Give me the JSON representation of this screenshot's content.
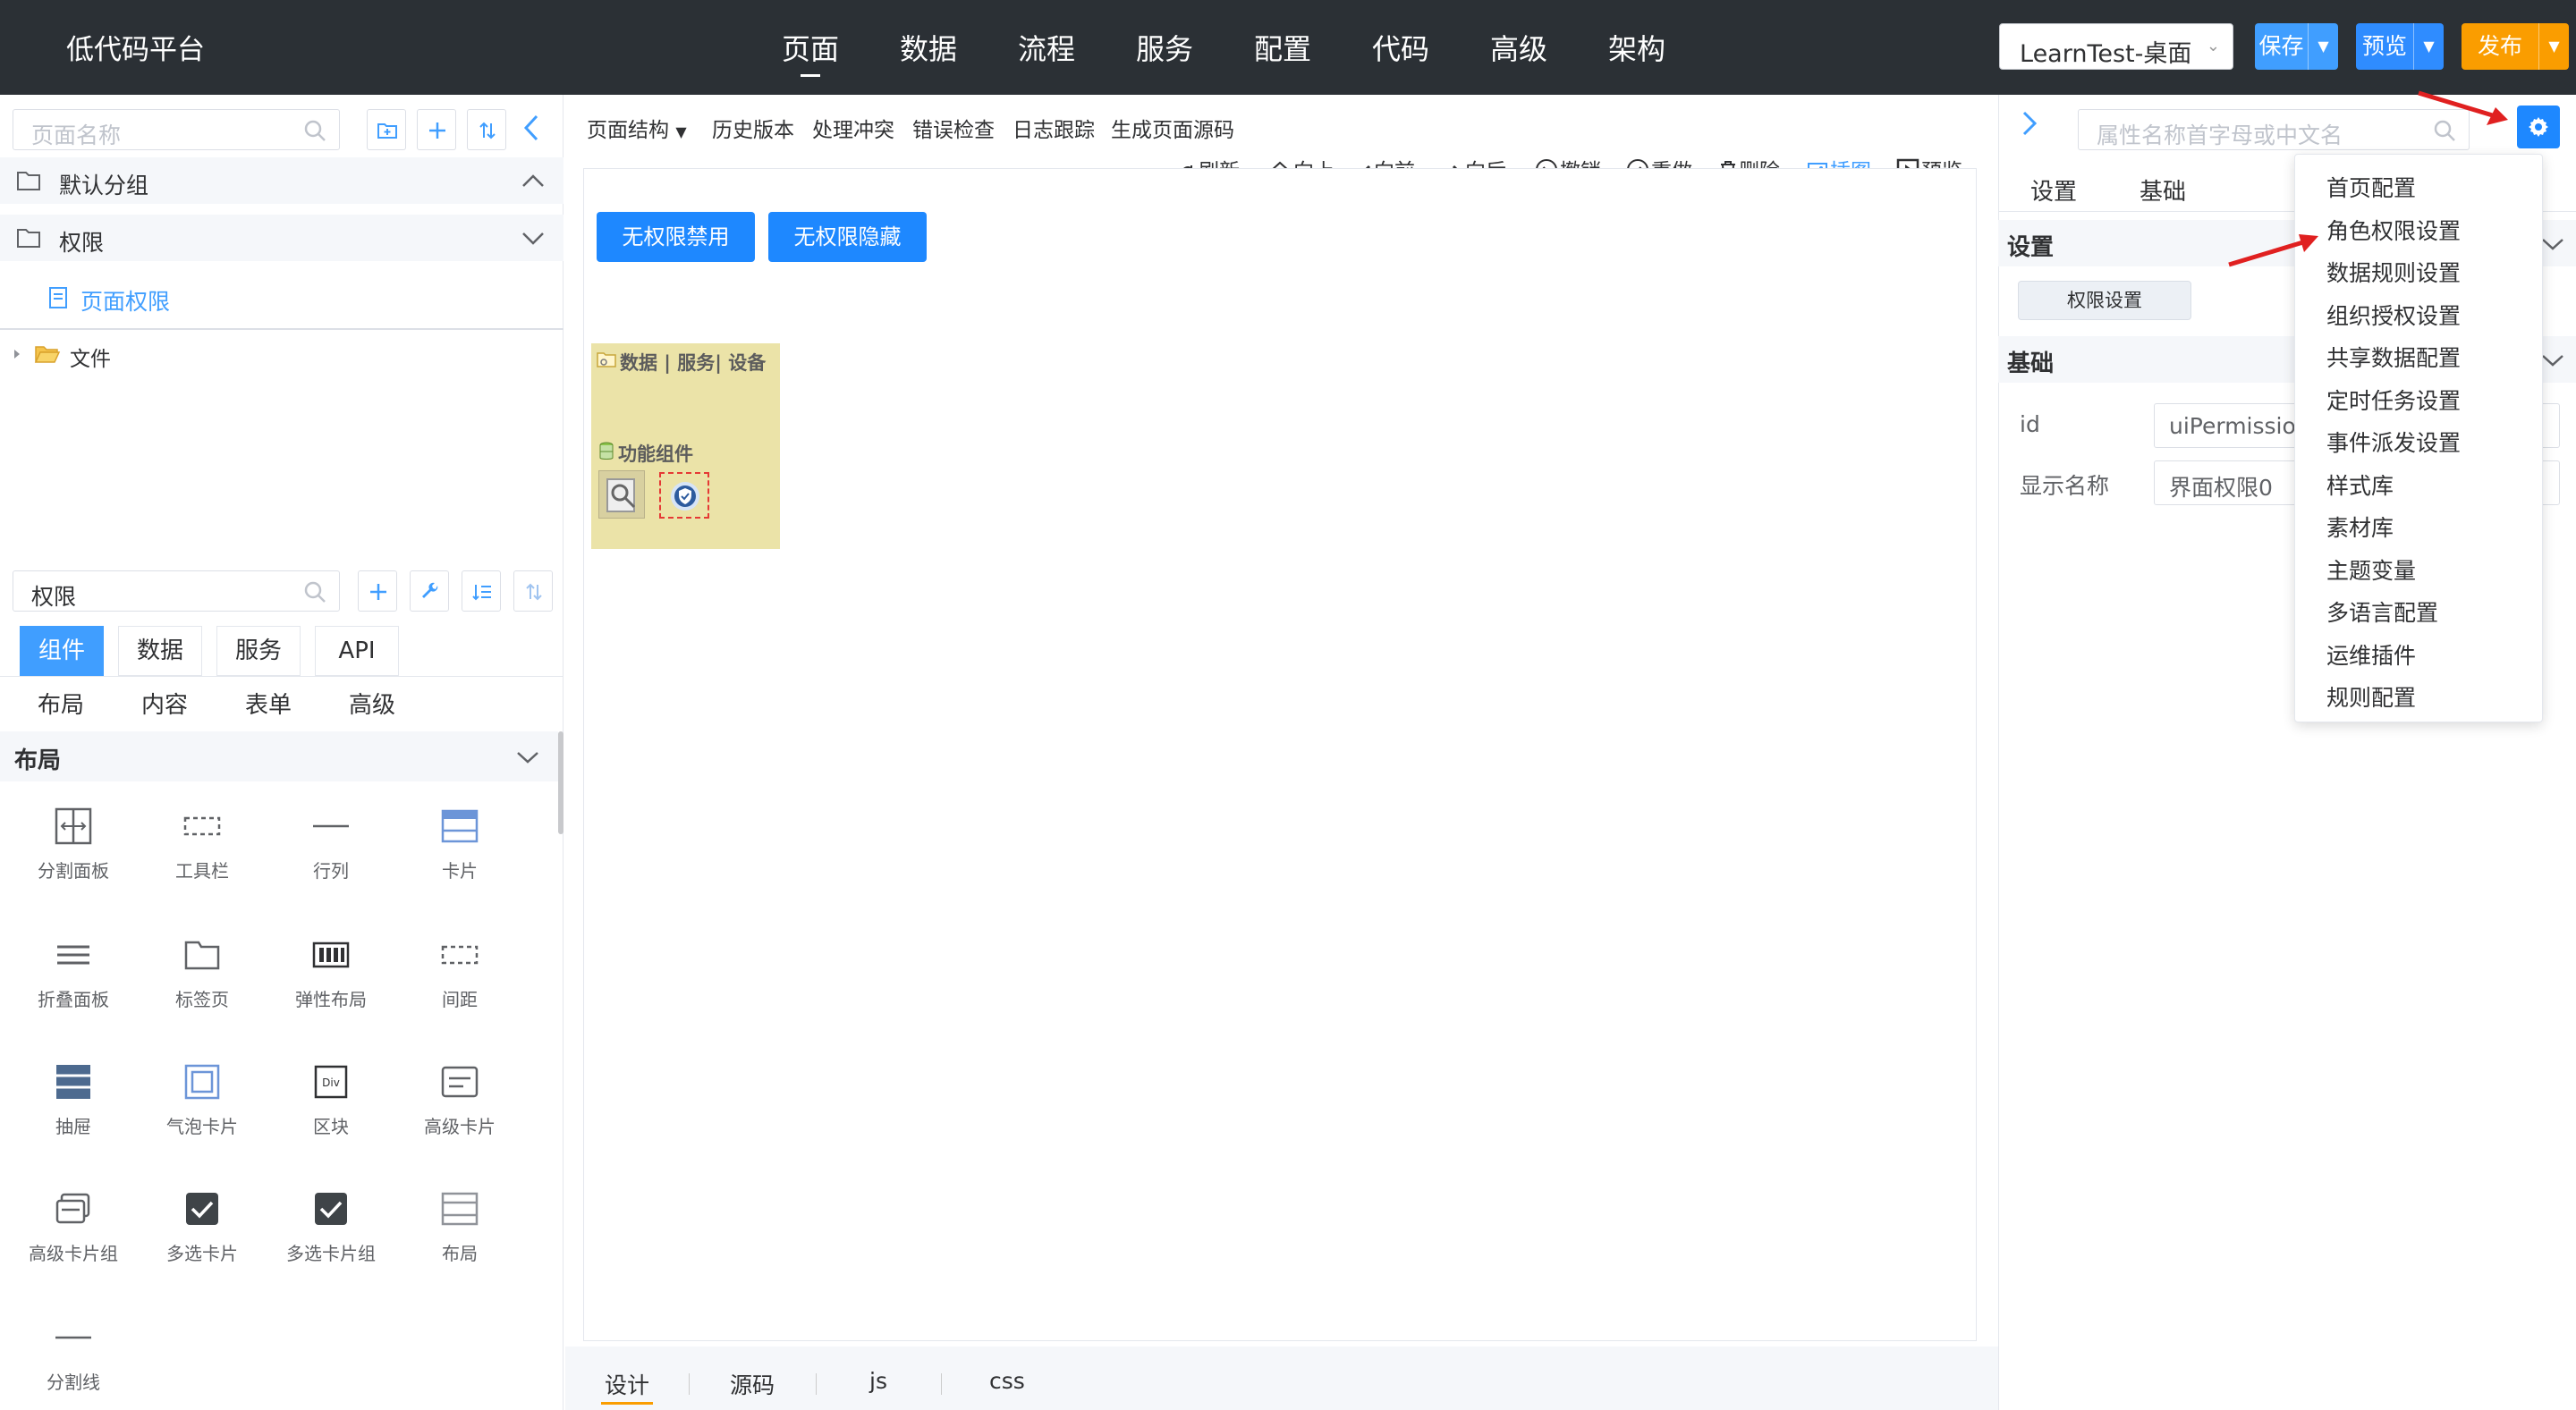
{
  "app": {
    "title": "低代码平台"
  },
  "nav": {
    "items": [
      "页面",
      "数据",
      "流程",
      "服务",
      "配置",
      "代码",
      "高级",
      "架构"
    ],
    "active": "页面"
  },
  "header": {
    "env_select": "LearnTest-桌面",
    "save_label": "保存",
    "preview_label": "预览",
    "publish_label": "发布",
    "colors": {
      "bar": "#2b3035",
      "save": "#409eff",
      "preview": "#2f8cff",
      "publish": "#fa9d00"
    }
  },
  "left": {
    "page_search_placeholder": "页面名称",
    "groups": [
      {
        "label": "默认分组",
        "expanded": true
      },
      {
        "label": "权限",
        "expanded": false
      }
    ],
    "selected_page": "页面权限",
    "file_node": "文件",
    "comp_search_value": "权限",
    "tabs": [
      "组件",
      "数据",
      "服务",
      "API"
    ],
    "active_tab": "组件",
    "sub_tabs": [
      "布局",
      "内容",
      "表单",
      "高级"
    ],
    "section_title": "布局",
    "components": [
      "分割面板",
      "工具栏",
      "行列",
      "卡片",
      "折叠面板",
      "标签页",
      "弹性布局",
      "间距",
      "抽屉",
      "气泡卡片",
      "区块",
      "高级卡片",
      "高级卡片组",
      "多选卡片",
      "多选卡片组",
      "布局",
      "分割线"
    ]
  },
  "middle": {
    "menu": [
      "页面结构",
      "历史版本",
      "处理冲突",
      "错误检查",
      "日志跟踪",
      "生成页面源码"
    ],
    "actions": [
      "刷新",
      "向上",
      "向前",
      "向后",
      "撤销",
      "重做",
      "删除",
      "插图",
      "预览"
    ],
    "canvas_buttons": [
      "无权限禁用",
      "无权限隐藏"
    ],
    "data_box_label": "数据 | 服务| 设备",
    "func_label": "功能组件",
    "bottom_tabs": [
      "设计",
      "源码",
      "js",
      "css"
    ],
    "active_bottom_tab": "设计"
  },
  "right": {
    "search_placeholder": "属性名称首字母或中文名",
    "tabs": [
      "设置",
      "基础"
    ],
    "section_settings": "设置",
    "perm_button": "权限设置",
    "section_basic": "基础",
    "fields": [
      {
        "label": "id",
        "value": "uiPermission"
      },
      {
        "label": "显示名称",
        "value": "界面权限0"
      }
    ]
  },
  "dropdown": {
    "items": [
      "首页配置",
      "角色权限设置",
      "数据规则设置",
      "组织授权设置",
      "共享数据配置",
      "定时任务设置",
      "事件派发设置",
      "样式库",
      "素材库",
      "主题变量",
      "多语言配置",
      "运维插件",
      "规则配置"
    ]
  }
}
